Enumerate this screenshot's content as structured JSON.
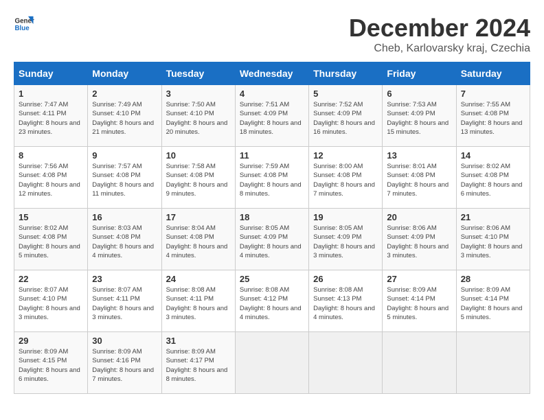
{
  "logo": {
    "line1": "General",
    "line2": "Blue"
  },
  "title": "December 2024",
  "subtitle": "Cheb, Karlovarsky kraj, Czechia",
  "weekdays": [
    "Sunday",
    "Monday",
    "Tuesday",
    "Wednesday",
    "Thursday",
    "Friday",
    "Saturday"
  ],
  "weeks": [
    [
      {
        "day": "1",
        "sunrise": "7:47 AM",
        "sunset": "4:11 PM",
        "daylight": "8 hours and 23 minutes."
      },
      {
        "day": "2",
        "sunrise": "7:49 AM",
        "sunset": "4:10 PM",
        "daylight": "8 hours and 21 minutes."
      },
      {
        "day": "3",
        "sunrise": "7:50 AM",
        "sunset": "4:10 PM",
        "daylight": "8 hours and 20 minutes."
      },
      {
        "day": "4",
        "sunrise": "7:51 AM",
        "sunset": "4:09 PM",
        "daylight": "8 hours and 18 minutes."
      },
      {
        "day": "5",
        "sunrise": "7:52 AM",
        "sunset": "4:09 PM",
        "daylight": "8 hours and 16 minutes."
      },
      {
        "day": "6",
        "sunrise": "7:53 AM",
        "sunset": "4:09 PM",
        "daylight": "8 hours and 15 minutes."
      },
      {
        "day": "7",
        "sunrise": "7:55 AM",
        "sunset": "4:08 PM",
        "daylight": "8 hours and 13 minutes."
      }
    ],
    [
      {
        "day": "8",
        "sunrise": "7:56 AM",
        "sunset": "4:08 PM",
        "daylight": "8 hours and 12 minutes."
      },
      {
        "day": "9",
        "sunrise": "7:57 AM",
        "sunset": "4:08 PM",
        "daylight": "8 hours and 11 minutes."
      },
      {
        "day": "10",
        "sunrise": "7:58 AM",
        "sunset": "4:08 PM",
        "daylight": "8 hours and 9 minutes."
      },
      {
        "day": "11",
        "sunrise": "7:59 AM",
        "sunset": "4:08 PM",
        "daylight": "8 hours and 8 minutes."
      },
      {
        "day": "12",
        "sunrise": "8:00 AM",
        "sunset": "4:08 PM",
        "daylight": "8 hours and 7 minutes."
      },
      {
        "day": "13",
        "sunrise": "8:01 AM",
        "sunset": "4:08 PM",
        "daylight": "8 hours and 7 minutes."
      },
      {
        "day": "14",
        "sunrise": "8:02 AM",
        "sunset": "4:08 PM",
        "daylight": "8 hours and 6 minutes."
      }
    ],
    [
      {
        "day": "15",
        "sunrise": "8:02 AM",
        "sunset": "4:08 PM",
        "daylight": "8 hours and 5 minutes."
      },
      {
        "day": "16",
        "sunrise": "8:03 AM",
        "sunset": "4:08 PM",
        "daylight": "8 hours and 4 minutes."
      },
      {
        "day": "17",
        "sunrise": "8:04 AM",
        "sunset": "4:08 PM",
        "daylight": "8 hours and 4 minutes."
      },
      {
        "day": "18",
        "sunrise": "8:05 AM",
        "sunset": "4:09 PM",
        "daylight": "8 hours and 4 minutes."
      },
      {
        "day": "19",
        "sunrise": "8:05 AM",
        "sunset": "4:09 PM",
        "daylight": "8 hours and 3 minutes."
      },
      {
        "day": "20",
        "sunrise": "8:06 AM",
        "sunset": "4:09 PM",
        "daylight": "8 hours and 3 minutes."
      },
      {
        "day": "21",
        "sunrise": "8:06 AM",
        "sunset": "4:10 PM",
        "daylight": "8 hours and 3 minutes."
      }
    ],
    [
      {
        "day": "22",
        "sunrise": "8:07 AM",
        "sunset": "4:10 PM",
        "daylight": "8 hours and 3 minutes."
      },
      {
        "day": "23",
        "sunrise": "8:07 AM",
        "sunset": "4:11 PM",
        "daylight": "8 hours and 3 minutes."
      },
      {
        "day": "24",
        "sunrise": "8:08 AM",
        "sunset": "4:11 PM",
        "daylight": "8 hours and 3 minutes."
      },
      {
        "day": "25",
        "sunrise": "8:08 AM",
        "sunset": "4:12 PM",
        "daylight": "8 hours and 4 minutes."
      },
      {
        "day": "26",
        "sunrise": "8:08 AM",
        "sunset": "4:13 PM",
        "daylight": "8 hours and 4 minutes."
      },
      {
        "day": "27",
        "sunrise": "8:09 AM",
        "sunset": "4:14 PM",
        "daylight": "8 hours and 5 minutes."
      },
      {
        "day": "28",
        "sunrise": "8:09 AM",
        "sunset": "4:14 PM",
        "daylight": "8 hours and 5 minutes."
      }
    ],
    [
      {
        "day": "29",
        "sunrise": "8:09 AM",
        "sunset": "4:15 PM",
        "daylight": "8 hours and 6 minutes."
      },
      {
        "day": "30",
        "sunrise": "8:09 AM",
        "sunset": "4:16 PM",
        "daylight": "8 hours and 7 minutes."
      },
      {
        "day": "31",
        "sunrise": "8:09 AM",
        "sunset": "4:17 PM",
        "daylight": "8 hours and 8 minutes."
      },
      null,
      null,
      null,
      null
    ]
  ]
}
